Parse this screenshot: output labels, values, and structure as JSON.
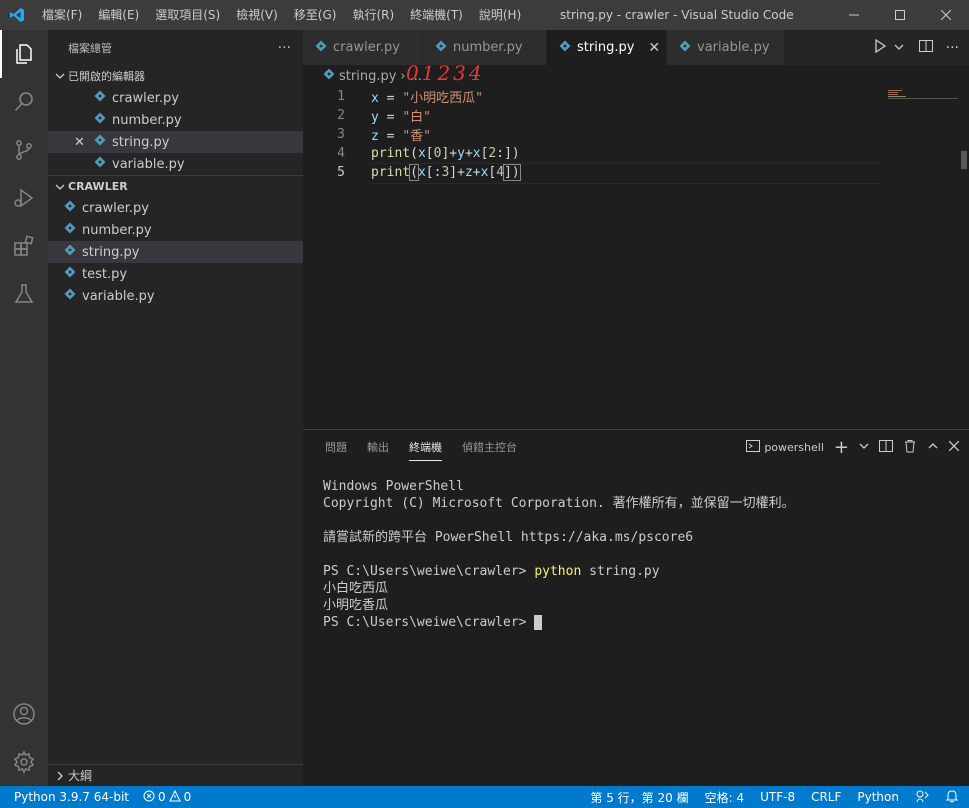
{
  "window": {
    "title": "string.py - crawler - Visual Studio Code",
    "menu": [
      "檔案(F)",
      "編輯(E)",
      "選取項目(S)",
      "檢視(V)",
      "移至(G)",
      "執行(R)",
      "終端機(T)",
      "說明(H)"
    ]
  },
  "sidebar": {
    "header": "檔案總管",
    "more": "···",
    "open_editors_title": "已開啟的編輯器",
    "open_editors": [
      "crawler.py",
      "number.py",
      "string.py",
      "variable.py"
    ],
    "open_editor_close": "✕",
    "folder_title": "CRAWLER",
    "files": [
      "crawler.py",
      "number.py",
      "string.py",
      "test.py",
      "variable.py"
    ],
    "outline_title": "大綱"
  },
  "tabs": [
    "crawler.py",
    "number.py",
    "string.py",
    "variable.py"
  ],
  "active_tab_close": "✕",
  "breadcrumb": {
    "file": "string.py",
    "sep": "›",
    "more": "...",
    "handwritten": "01234"
  },
  "code": {
    "line_numbers": [
      "1",
      "2",
      "3",
      "4",
      "5"
    ],
    "lines": [
      {
        "var": "x",
        "op": " = ",
        "str": "\"小明吃西瓜\""
      },
      {
        "var": "y",
        "op": " = ",
        "str": "\"白\""
      },
      {
        "var": "z",
        "op": " = ",
        "str": "\"香\""
      },
      {
        "fn": "print",
        "a": "(",
        "b": "x",
        "c": "[",
        "n1": "0",
        "d": "]+",
        "e": "y",
        "f": "+",
        "g": "x",
        "h": "[",
        "n2": "2",
        "i": ":])"
      },
      {
        "fn": "print",
        "a": "(",
        "b": "x",
        "c": "[:",
        "n1": "3",
        "d": "]+",
        "e": "z",
        "f": "+",
        "g": "x",
        "h": "[",
        "n2": "4",
        "i": "])"
      }
    ]
  },
  "panel": {
    "tabs": [
      "問題",
      "輸出",
      "終端機",
      "偵錯主控台"
    ],
    "active_tab": "終端機",
    "shell": "powershell",
    "terminal_lines": [
      "Windows PowerShell",
      "Copyright (C) Microsoft Corporation. 著作權所有，並保留一切權利。",
      "",
      "請嘗試新的跨平台 PowerShell https://aka.ms/pscore6",
      "",
      "PS C:\\Users\\weiwe\\crawler> ",
      "小白吃西瓜",
      "小明吃香瓜",
      "PS C:\\Users\\weiwe\\crawler> "
    ],
    "command": "python",
    "command_args": " string.py"
  },
  "status": {
    "python": "Python 3.9.7 64-bit",
    "errors": "0",
    "warnings": "0",
    "position": "第 5 行，第 20 欄",
    "spaces": "空格: 4",
    "encoding": "UTF-8",
    "eol": "CRLF",
    "language": "Python"
  },
  "colors": {
    "accent": "#007acc",
    "python_icon": "#519aba",
    "vscode_logo": "#23a9f2"
  }
}
